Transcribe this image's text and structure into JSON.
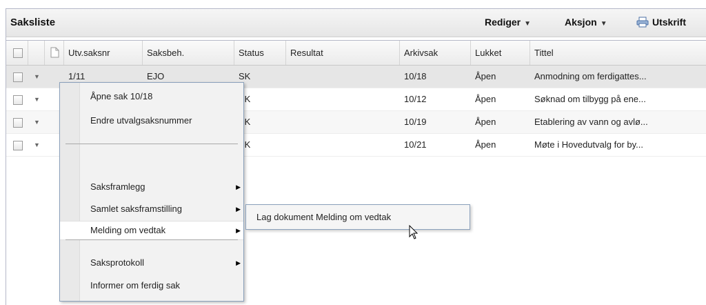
{
  "panel": {
    "title": "Saksliste",
    "toolbar": {
      "rediger": "Rediger",
      "aksjon": "Aksjon",
      "utskrift": "Utskrift"
    }
  },
  "table": {
    "headers": [
      "",
      "",
      "",
      "Utv.saksnr",
      "Saksbeh.",
      "Status",
      "Resultat",
      "Arkivsak",
      "Lukket",
      "Tittel"
    ],
    "rows": [
      {
        "utvsaksnr": "1/11",
        "saksbeh": "EJO",
        "status": "SK",
        "resultat": "",
        "arkivsak": "10/18",
        "lukket": "Åpen",
        "tittel": "Anmodning om ferdigattes..."
      },
      {
        "utvsaksnr": "",
        "saksbeh": "",
        "status": "SK",
        "resultat": "",
        "arkivsak": "10/12",
        "lukket": "Åpen",
        "tittel": "Søknad om tilbygg på ene..."
      },
      {
        "utvsaksnr": "",
        "saksbeh": "",
        "status": "SK",
        "resultat": "",
        "arkivsak": "10/19",
        "lukket": "Åpen",
        "tittel": "Etablering av vann og avlø..."
      },
      {
        "utvsaksnr": "",
        "saksbeh": "",
        "status": "SK",
        "resultat": "",
        "arkivsak": "10/21",
        "lukket": "Åpen",
        "tittel": "Møte i Hovedutvalg for by..."
      }
    ]
  },
  "context_menu": {
    "items": [
      {
        "label": "Åpne sak 10/18"
      },
      {
        "label": "Endre utvalgsaksnummer"
      },
      {
        "label": "Saksframlegg"
      },
      {
        "label": "Samlet saksframstilling"
      },
      {
        "label": "Melding om vedtak"
      },
      {
        "label": "Saksprotokoll"
      },
      {
        "label": "Informer om ferdig sak"
      }
    ]
  },
  "submenu": {
    "item": "Lag dokument Melding om vedtak"
  }
}
